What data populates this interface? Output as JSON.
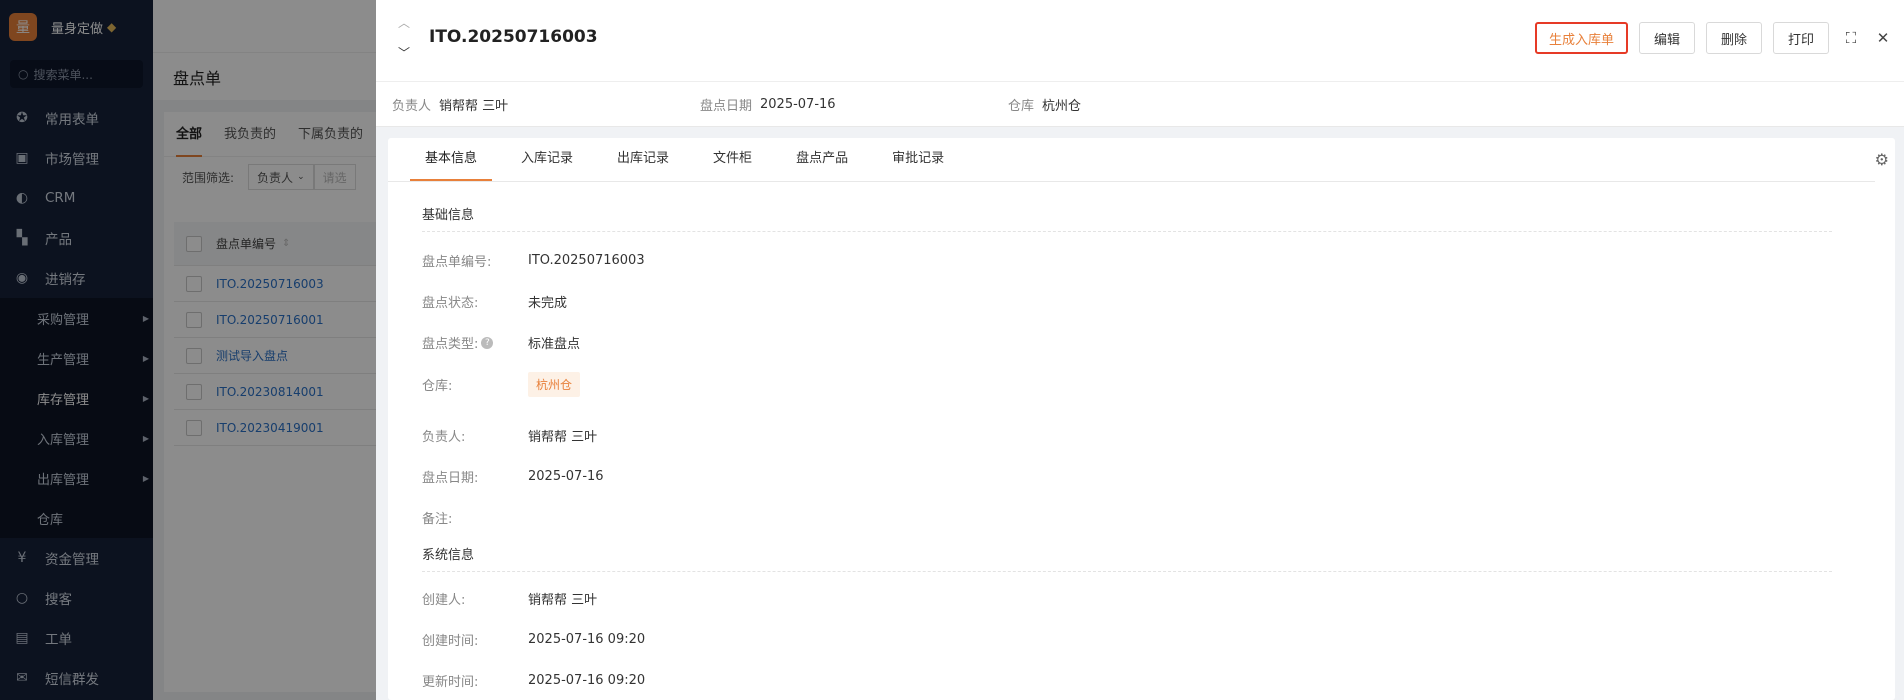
{
  "sidebar": {
    "brand_logo": "量",
    "brand_name": "量身定做",
    "search_placeholder": "搜索菜单...",
    "items": [
      {
        "label": "常用表单",
        "icon": "star-icon"
      },
      {
        "label": "市场管理",
        "icon": "clipboard-icon"
      },
      {
        "label": "CRM",
        "icon": "pie-icon"
      },
      {
        "label": "产品",
        "icon": "blocks-icon"
      },
      {
        "label": "进销存",
        "icon": "cycle-icon"
      }
    ],
    "subitems": [
      {
        "label": "采购管理"
      },
      {
        "label": "生产管理"
      },
      {
        "label": "库存管理"
      },
      {
        "label": "入库管理"
      },
      {
        "label": "出库管理"
      },
      {
        "label": "仓库"
      }
    ],
    "items_bottom": [
      {
        "label": "资金管理",
        "icon": "money-icon"
      },
      {
        "label": "搜客",
        "icon": "search-icon"
      },
      {
        "label": "工单",
        "icon": "ticket-icon"
      },
      {
        "label": "短信群发",
        "icon": "mail-icon"
      }
    ]
  },
  "background": {
    "page_title": "盘点单",
    "tabs": [
      "全部",
      "我负责的",
      "下属负责的"
    ],
    "filter_label": "范围筛选:",
    "filter_select": "负责人",
    "filter_placeholder": "请选",
    "column_header": "盘点单编号",
    "rows": [
      "ITO.20250716003",
      "ITO.20250716001",
      "测试导入盘点",
      "ITO.20230814001",
      "ITO.20230419001"
    ]
  },
  "drawer": {
    "title": "ITO.20250716003",
    "actions": {
      "generate": "生成入库单",
      "edit": "编辑",
      "delete": "删除",
      "print": "打印"
    },
    "summary": {
      "owner_label": "负责人",
      "owner_value": "销帮帮 三叶",
      "date_label": "盘点日期",
      "date_value": "2025-07-16",
      "warehouse_label": "仓库",
      "warehouse_value": "杭州仓"
    },
    "tabs": [
      "基本信息",
      "入库记录",
      "出库记录",
      "文件柜",
      "盘点产品",
      "审批记录"
    ],
    "basic_section": "基础信息",
    "system_section": "系统信息",
    "fields": {
      "code_label": "盘点单编号:",
      "code_value": "ITO.20250716003",
      "status_label": "盘点状态:",
      "status_value": "未完成",
      "type_label": "盘点类型:",
      "type_value": "标准盘点",
      "warehouse_label": "仓库:",
      "warehouse_value": "杭州仓",
      "owner_label": "负责人:",
      "owner_value": "销帮帮 三叶",
      "date_label": "盘点日期:",
      "date_value": "2025-07-16",
      "remark_label": "备注:",
      "remark_value": "",
      "creator_label": "创建人:",
      "creator_value": "销帮帮 三叶",
      "created_label": "创建时间:",
      "created_value": "2025-07-16 09:20",
      "updated_label": "更新时间:",
      "updated_value": "2025-07-16 09:20"
    }
  },
  "colors": {
    "accent": "#e8803a",
    "highlight_border": "#e63a26",
    "sidebar_bg": "#16223a"
  }
}
